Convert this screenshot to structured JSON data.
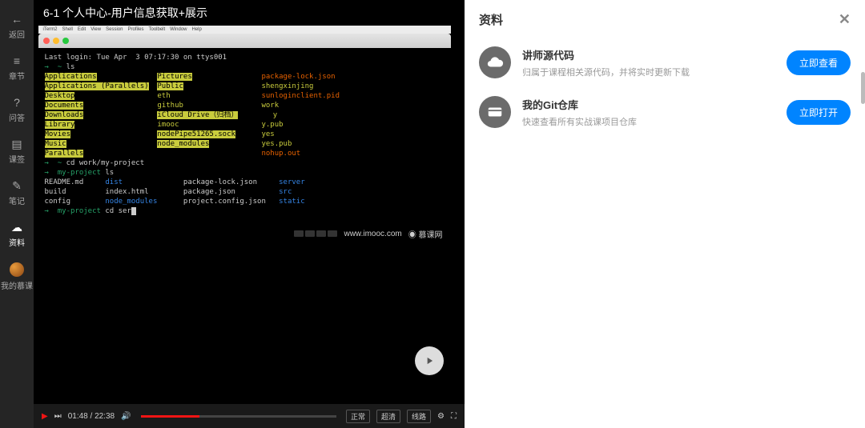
{
  "sidebar": {
    "back": "返回",
    "chapters": "章节",
    "qa": "问答",
    "bookmark": "课签",
    "notes": "笔记",
    "resources": "资料",
    "my": "我的慕课"
  },
  "title": "6-1 个人中心-用户信息获取+展示",
  "terminal": {
    "menu": [
      "iTerm2",
      "Shell",
      "Edit",
      "View",
      "Session",
      "Profiles",
      "Toolbelt",
      "Window",
      "Help"
    ],
    "lastLogin": "Last login: Tue Apr  3 07:17:30 on ttys001",
    "prompt1": "→  ~ ",
    "cmd1": "ls",
    "col1": [
      "Applications",
      "Applications (Parallels)",
      "Desktop",
      "Documents",
      "Downloads",
      "Library",
      "Movies",
      "Music",
      "Parallels"
    ],
    "col2": [
      "Pictures",
      "Public",
      "eth",
      "github",
      "iCloud Drive（归档）",
      "imooc",
      "nodePipe51265.sock",
      "node_modules",
      ""
    ],
    "col3": [
      "package-lock.json",
      "shengxinjing",
      "sunloginclient.pid",
      "work",
      "y",
      "y.pub",
      "yes",
      "yes.pub",
      "nohup.out"
    ],
    "prompt2": "→  ~ ",
    "cmd2": "cd work/my-project",
    "prompt3": "→  my-project ",
    "cmd3": "ls",
    "proj": [
      [
        "README.md",
        "dist",
        "package-lock.json",
        "server"
      ],
      [
        "build",
        "index.html",
        "package.json",
        "src"
      ],
      [
        "config",
        "node_modules",
        "project.config.json",
        "static"
      ]
    ],
    "prompt4": "→  my-project ",
    "cmd4": "cd ser",
    "watermark": "www.imooc.com",
    "brand": "慕课网"
  },
  "controls": {
    "time": "01:48 / 22:38",
    "speed": "正常",
    "quality": "超清",
    "route": "线路"
  },
  "panel": {
    "title": "资料",
    "items": [
      {
        "title": "讲师源代码",
        "desc": "归属于课程相关源代码，并将实时更新下载",
        "btn": "立即查看",
        "icon": "cloud"
      },
      {
        "title": "我的Git仓库",
        "desc": "快速查看所有实战课项目仓库",
        "btn": "立即打开",
        "icon": "card"
      }
    ]
  }
}
